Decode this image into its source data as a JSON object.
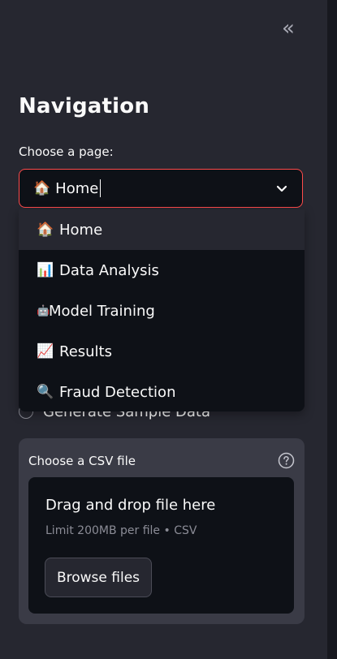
{
  "sidebar": {
    "collapse_icon": "double-chevron-left-icon",
    "collapse_glyph": "«",
    "heading": "Navigation",
    "select": {
      "label": "Choose a page:",
      "value": "Home",
      "value_emoji": "🏠",
      "chevron_icon": "chevron-down-icon",
      "options": [
        {
          "emoji": "🏠",
          "label": "Home",
          "selected": true
        },
        {
          "emoji": "📊",
          "label": "Data Analysis",
          "selected": false
        },
        {
          "emoji": "🤖",
          "label": "Model Training",
          "selected": false
        },
        {
          "emoji": "📈",
          "label": "Results",
          "selected": false
        },
        {
          "emoji": "🔍",
          "label": "Fraud Detection",
          "selected": false
        }
      ]
    },
    "radio_option": {
      "label": "Generate Sample Data",
      "checked": false
    },
    "uploader": {
      "label": "Choose a CSV file",
      "help_icon": "question-circle-icon",
      "drop_title": "Drag and drop file here",
      "drop_subtitle": "Limit 200MB per file • CSV",
      "browse_label": "Browse files"
    }
  },
  "colors": {
    "sidebar_bg": "#262730",
    "input_bg": "#0e1117",
    "accent_focus": "#ff4b4b",
    "text": "#fafafa",
    "muted_text": "#8b8c96",
    "card_bg": "#3a3b46"
  }
}
